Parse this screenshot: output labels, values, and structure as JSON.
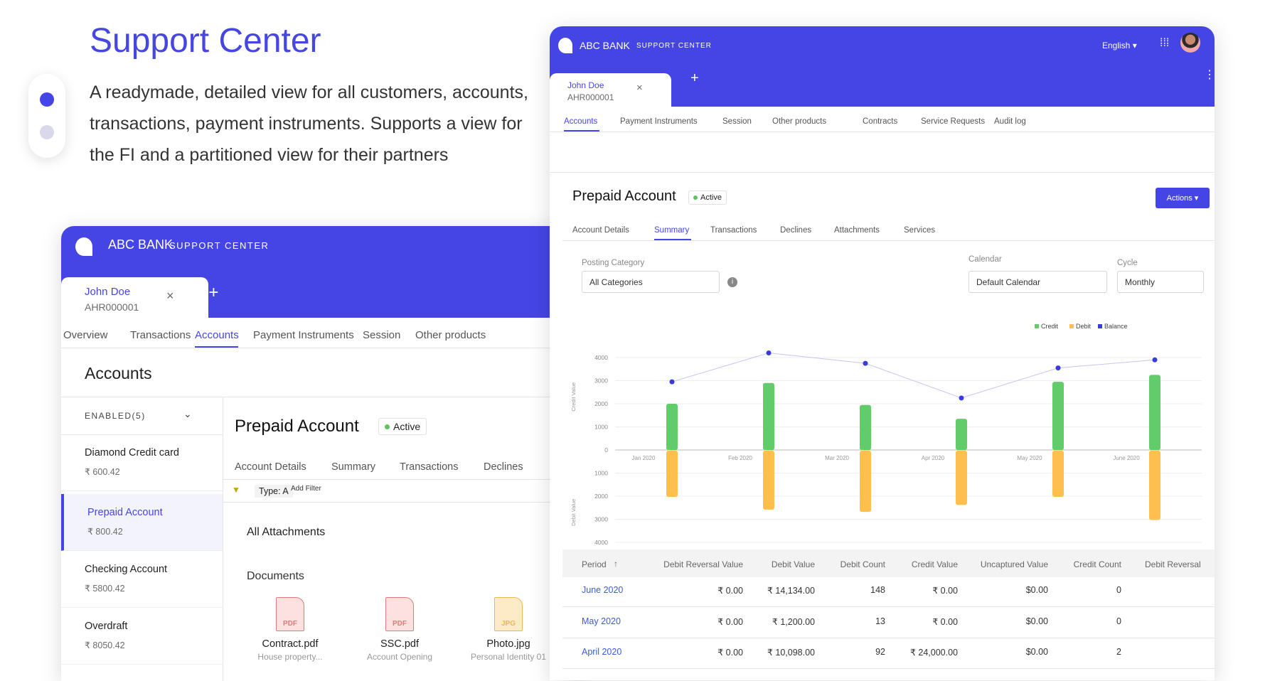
{
  "hero": {
    "title": "Support Center",
    "text": "A readymade, detailed view for all customers, accounts, transactions, payment instruments. Supports a view for the FI and a partitioned view for their partners"
  },
  "colors": {
    "brand": "#4545e6",
    "credit": "#63cc6a",
    "debit": "#ffbf4f",
    "balance": "#3b3bdc"
  },
  "left": {
    "brand": "ABC BANK",
    "product": "SUPPORT CENTER",
    "customer": {
      "name": "John Doe",
      "id": "AHR000001"
    },
    "tabs": [
      "Overview",
      "Transactions",
      "Accounts",
      "Payment Instruments",
      "Session",
      "Other products"
    ],
    "section_title": "Accounts",
    "group": "ENABLED(5)",
    "accounts": [
      {
        "name": "Diamond Credit card",
        "amount": "₹ 600.42"
      },
      {
        "name": "Prepaid Account",
        "amount": "₹ 800.42"
      },
      {
        "name": "Checking Account",
        "amount": "₹ 5800.42"
      },
      {
        "name": "Overdraft",
        "amount": "₹ 8050.42"
      }
    ],
    "account_title": "Prepaid Account",
    "status": "Active",
    "subtabs": [
      "Account Details",
      "Summary",
      "Transactions",
      "Declines"
    ],
    "filter_chip": "Type: A",
    "add_filter": "Add Filter",
    "attachments_title": "All Attachments",
    "documents_title": "Documents",
    "documents": [
      {
        "type": "PDF",
        "name": "Contract.pdf",
        "desc": "House property..."
      },
      {
        "type": "PDF",
        "name": "SSC.pdf",
        "desc": "Account Opening"
      },
      {
        "type": "JPG",
        "name": "Photo.jpg",
        "desc": "Personal Identity 01"
      }
    ]
  },
  "right": {
    "brand": "ABC BANK",
    "product": "SUPPORT CENTER",
    "language": "English",
    "customer": {
      "name": "John Doe",
      "id": "AHR000001"
    },
    "tabs": [
      "Accounts",
      "Payment Instruments",
      "Session",
      "Other products",
      "Contracts",
      "Service Requests",
      "Audit log"
    ],
    "account_title": "Prepaid Account",
    "status": "Active",
    "actions": "Actions",
    "subtabs": [
      "Account Details",
      "Summary",
      "Transactions",
      "Declines",
      "Attachments",
      "Services"
    ],
    "filters": {
      "posting_label": "Posting Category",
      "posting_value": "All Categories",
      "calendar_label": "Calendar",
      "calendar_value": "Default Calendar",
      "cycle_label": "Cycle",
      "cycle_value": "Monthly"
    },
    "table": {
      "headers": [
        "Period",
        "Debit Reversal Value",
        "Debit Value",
        "Debit Count",
        "Credit Value",
        "Uncaptured Value",
        "Credit Count",
        "Debit Reversal Co"
      ],
      "rows": [
        [
          "June 2020",
          "₹ 0.00",
          "₹ 14,134.00",
          "148",
          "₹ 0.00",
          "$0.00",
          "0"
        ],
        [
          "May 2020",
          "₹ 0.00",
          "₹ 1,200.00",
          "13",
          "₹ 0.00",
          "$0.00",
          "0"
        ],
        [
          "April 2020",
          "₹ 0.00",
          "₹ 10,098.00",
          "92",
          "₹ 24,000.00",
          "$0.00",
          "2"
        ]
      ]
    }
  },
  "chart_data": {
    "type": "bar",
    "categories": [
      "Jan 2020",
      "Feb 2020",
      "Mar 2020",
      "Apr 2020",
      "May 2020",
      "June 2020"
    ],
    "series": [
      {
        "name": "Credit",
        "values": [
          2000,
          2900,
          1950,
          1350,
          2950,
          3250
        ]
      },
      {
        "name": "Debit",
        "values": [
          2000,
          2550,
          2650,
          2350,
          2000,
          3000
        ]
      },
      {
        "name": "Balance",
        "type": "line",
        "values": [
          2950,
          4200,
          3750,
          2250,
          3550,
          3900
        ]
      }
    ],
    "ylabel_top": "Credit Value",
    "ylabel_bottom": "Debit Value",
    "yticks": [
      "4000",
      "3000",
      "2000",
      "1000",
      "0",
      "1000",
      "2000",
      "3000",
      "4000"
    ],
    "ylim": [
      -4000,
      4000
    ],
    "grid": true,
    "legend": "top-right"
  }
}
